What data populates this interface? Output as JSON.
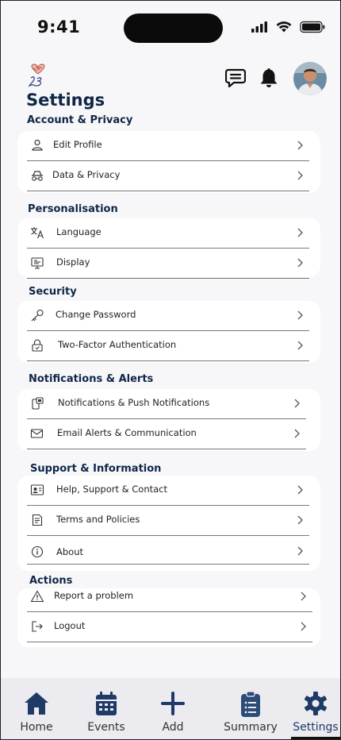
{
  "status_bar": {
    "time": "9:41"
  },
  "header": {
    "logo_icon": "heart-hands-logo",
    "chat_icon": "chat-icon",
    "bell_icon": "bell-icon",
    "title": "Settings"
  },
  "sections": [
    {
      "title": "Account & Privacy",
      "items": [
        {
          "label": "Edit Profile",
          "icon": "person-icon"
        },
        {
          "label": "Data & Privacy",
          "icon": "incognito-icon"
        }
      ]
    },
    {
      "title": "Personalisation",
      "items": [
        {
          "label": "Language",
          "icon": "translate-icon"
        },
        {
          "label": "Display",
          "icon": "display-icon"
        }
      ]
    },
    {
      "title": "Security",
      "items": [
        {
          "label": "Change Password",
          "icon": "key-icon"
        },
        {
          "label": "Two-Factor Authentication",
          "icon": "lock-icon"
        }
      ]
    },
    {
      "title": "Notifications & Alerts",
      "items": [
        {
          "label": "Notifications & Push Notifications",
          "icon": "notification-icon"
        },
        {
          "label": "Email Alerts & Communication",
          "icon": "mail-icon"
        }
      ]
    },
    {
      "title": "Support & Information",
      "items": [
        {
          "label": "Help, Support & Contact",
          "icon": "contact-card-icon"
        },
        {
          "label": "Terms and Policies",
          "icon": "document-icon"
        },
        {
          "label": "About",
          "icon": "info-icon"
        }
      ]
    },
    {
      "title": "Actions",
      "items": [
        {
          "label": "Report a problem",
          "icon": "warning-icon"
        },
        {
          "label": "Logout",
          "icon": "logout-icon"
        }
      ]
    }
  ],
  "tabbar": {
    "active": "Settings",
    "tabs": [
      {
        "label": "Home",
        "icon": "home-icon"
      },
      {
        "label": "Events",
        "icon": "calendar-icon"
      },
      {
        "label": "Add",
        "icon": "plus-icon"
      },
      {
        "label": "Summary",
        "icon": "clipboard-icon"
      },
      {
        "label": "Settings",
        "icon": "gear-icon"
      }
    ]
  },
  "colors": {
    "accent": "#1f3a66",
    "title": "#0f2747",
    "background": "#f7f7f9",
    "card": "#ffffff",
    "tabbar": "#ebebf0"
  }
}
